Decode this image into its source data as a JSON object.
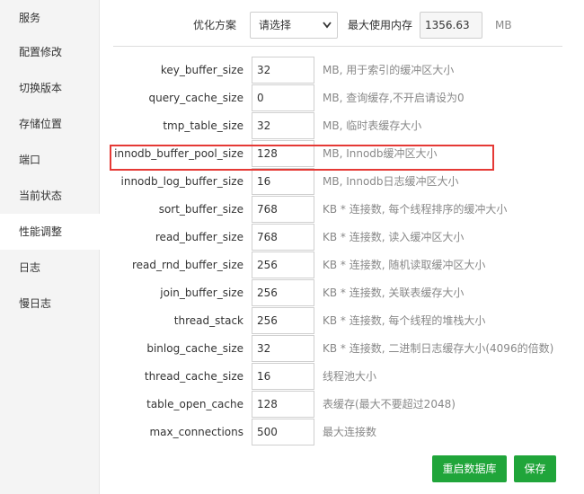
{
  "sidebar": {
    "items": [
      {
        "label": "服务"
      },
      {
        "label": "配置修改"
      },
      {
        "label": "切换版本"
      },
      {
        "label": "存储位置"
      },
      {
        "label": "端口"
      },
      {
        "label": "当前状态"
      },
      {
        "label": "性能调整",
        "active": true
      },
      {
        "label": "日志"
      },
      {
        "label": "慢日志"
      }
    ]
  },
  "top": {
    "scheme_label": "优化方案",
    "scheme_value": "请选择",
    "memory_label": "最大使用内存",
    "memory_value": "1356.63",
    "memory_unit": "MB"
  },
  "params": [
    {
      "name": "key_buffer_size",
      "value": "32",
      "desc": "MB, 用于索引的缓冲区大小"
    },
    {
      "name": "query_cache_size",
      "value": "0",
      "desc": "MB, 查询缓存,不开启请设为0"
    },
    {
      "name": "tmp_table_size",
      "value": "32",
      "desc": "MB, 临时表缓存大小"
    },
    {
      "name": "innodb_buffer_pool_size",
      "value": "128",
      "desc": "MB, Innodb缓冲区大小",
      "highlighted": true
    },
    {
      "name": "innodb_log_buffer_size",
      "value": "16",
      "desc": "MB, Innodb日志缓冲区大小"
    },
    {
      "name": "sort_buffer_size",
      "value": "768",
      "desc": "KB * 连接数, 每个线程排序的缓冲大小"
    },
    {
      "name": "read_buffer_size",
      "value": "768",
      "desc": "KB * 连接数, 读入缓冲区大小"
    },
    {
      "name": "read_rnd_buffer_size",
      "value": "256",
      "desc": "KB * 连接数, 随机读取缓冲区大小"
    },
    {
      "name": "join_buffer_size",
      "value": "256",
      "desc": "KB * 连接数, 关联表缓存大小"
    },
    {
      "name": "thread_stack",
      "value": "256",
      "desc": "KB * 连接数, 每个线程的堆栈大小"
    },
    {
      "name": "binlog_cache_size",
      "value": "32",
      "desc": "KB * 连接数, 二进制日志缓存大小(4096的倍数)"
    },
    {
      "name": "thread_cache_size",
      "value": "16",
      "desc": "线程池大小"
    },
    {
      "name": "table_open_cache",
      "value": "128",
      "desc": "表缓存(最大不要超过2048)"
    },
    {
      "name": "max_connections",
      "value": "500",
      "desc": "最大连接数"
    }
  ],
  "buttons": {
    "restart": "重启数据库",
    "save": "保存"
  },
  "colors": {
    "accent": "#20a53a",
    "highlight": "#e53935"
  }
}
